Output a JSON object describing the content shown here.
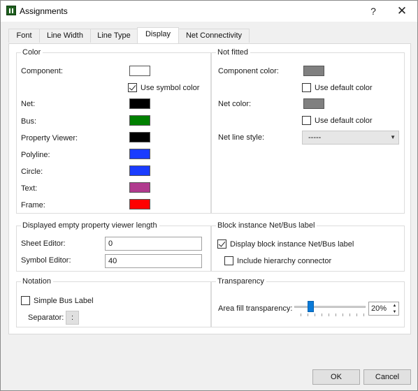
{
  "window": {
    "title": "Assignments",
    "help": "?",
    "close": "✕"
  },
  "tabs": [
    {
      "label": "Font"
    },
    {
      "label": "Line Width"
    },
    {
      "label": "Line Type"
    },
    {
      "label": "Display"
    },
    {
      "label": "Net Connectivity"
    }
  ],
  "active_tab": "Display",
  "color_group": {
    "title": "Color",
    "component_label": "Component:",
    "component_color": "#ffffff",
    "use_symbol_color_label": "Use symbol color",
    "use_symbol_color_checked": true,
    "rows": [
      {
        "label": "Net:",
        "color": "#000000"
      },
      {
        "label": "Bus:",
        "color": "#008000"
      },
      {
        "label": "Property Viewer:",
        "color": "#000000"
      },
      {
        "label": "Polyline:",
        "color": "#1a3cff"
      },
      {
        "label": "Circle:",
        "color": "#1a3cff"
      },
      {
        "label": "Text:",
        "color": "#b03a8e"
      },
      {
        "label": "Frame:",
        "color": "#ff0000"
      }
    ]
  },
  "not_fitted_group": {
    "title": "Not fitted",
    "component_color_label": "Component color:",
    "component_color": "#808080",
    "use_default_color_1": "Use default color",
    "net_color_label": "Net color:",
    "net_color": "#808080",
    "use_default_color_2": "Use default color",
    "net_line_style_label": "Net line style:",
    "net_line_style_value": "-----"
  },
  "viewer_length_group": {
    "title": "Displayed empty property viewer length",
    "sheet_editor_label": "Sheet Editor:",
    "sheet_editor_value": "0",
    "symbol_editor_label": "Symbol Editor:",
    "symbol_editor_value": "40"
  },
  "block_label_group": {
    "title": "Block instance Net/Bus label",
    "display_label": "Display block instance Net/Bus label",
    "display_checked": true,
    "include_label": "Include hierarchy connector",
    "include_checked": false
  },
  "notation_group": {
    "title": "Notation",
    "simple_bus_label": "Simple Bus Label",
    "simple_bus_checked": false,
    "separator_label": "Separator:",
    "separator_value": ":"
  },
  "transparency_group": {
    "title": "Transparency",
    "area_fill_label": "Area fill transparency:",
    "area_fill_value": "20%",
    "area_fill_fraction": 0.2
  },
  "footer": {
    "ok": "OK",
    "cancel": "Cancel"
  }
}
